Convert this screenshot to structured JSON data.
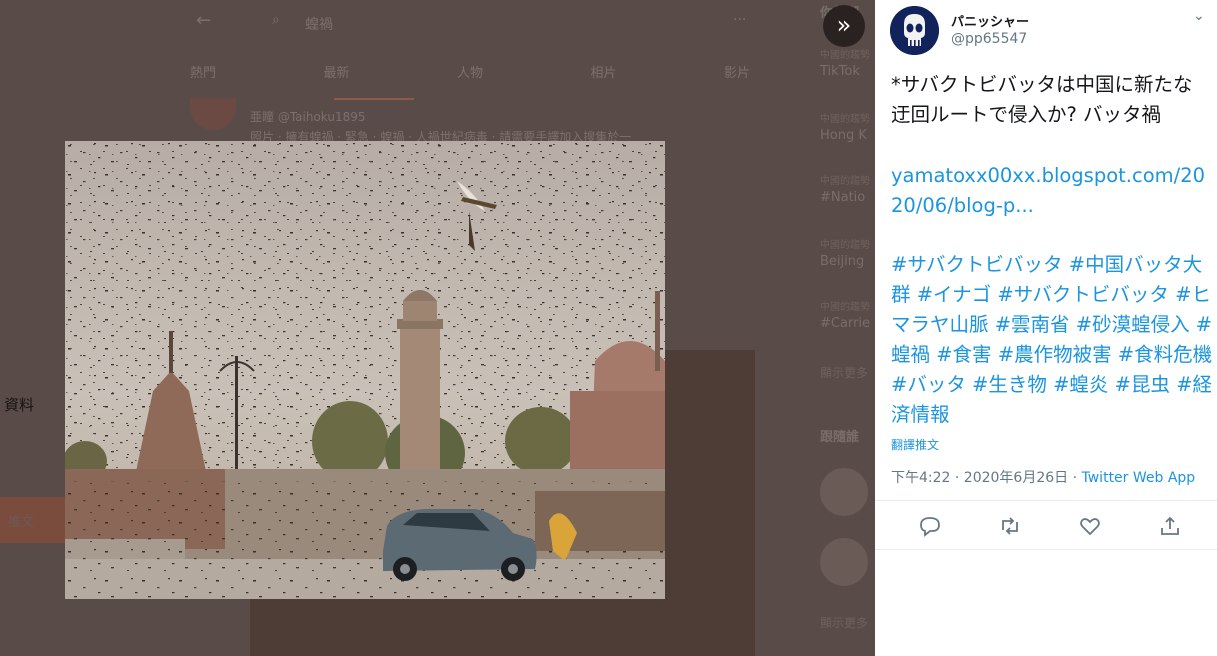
{
  "background": {
    "back_glyph": "←",
    "search_glyph": "⌕",
    "search_query": "蝗禍",
    "more_glyph": "···",
    "tabs": [
      "熱門",
      "最新",
      "人物",
      "相片",
      "影片"
    ],
    "result_author": "亜瞳 @Taihoku1895",
    "result_text": "照片 · 擁有蝗禍 · 緊急 · 蝗禍 · 人禍世紀病毒 · 請需要手譯加入搜集於一",
    "side_label": "資料",
    "tweet_button": "推文",
    "trends_header": "你的潮",
    "trends": [
      {
        "sub": "中國的趨勢",
        "title": "TikTok"
      },
      {
        "sub": "中國的趨勢",
        "title": "Hong K"
      },
      {
        "sub": "中國的趨勢",
        "title": "#Natio"
      },
      {
        "sub": "中國的趨勢",
        "title": "Beijing"
      },
      {
        "sub": "中國的趨勢",
        "title": "#Carrie"
      }
    ],
    "show_more": "顯示更多",
    "follow_header": "跟隨誰",
    "show_more_2": "顯示更多"
  },
  "collapse_glyph": "»",
  "tweet": {
    "name": "パニッシャー",
    "handle": "@pp65547",
    "caret_glyph": "⌄",
    "text": "*サバクトビバッタは中国に新たな迂回ルートで侵入か? バッタ禍",
    "link": "yamatoxx00xx.blogspot.com/2020/06/blog-p...",
    "hashtags": [
      "#サバクトビバッタ",
      "#中国バッタ大群",
      "#イナゴ",
      "#サバクトビバッタ",
      "#ヒマラヤ山脈",
      "#雲南省",
      "#砂漠蝗侵入",
      "#蝗禍",
      "#食害",
      "#農作物被害",
      "#食料危機",
      "#バッタ",
      "#生き物",
      "#蝗炎",
      "#昆虫",
      "#経済情報"
    ],
    "translate": "翻譯推文",
    "time": "下午4:22 · 2020年6月26日 · ",
    "app": "Twitter Web App"
  },
  "colors": {
    "accent": "#1b95e0",
    "overlay": "#594c48",
    "text": "#14171a",
    "muted": "#657786"
  },
  "icons": {
    "reply": "reply-icon",
    "retweet": "retweet-icon",
    "like": "like-icon",
    "share": "share-icon"
  }
}
